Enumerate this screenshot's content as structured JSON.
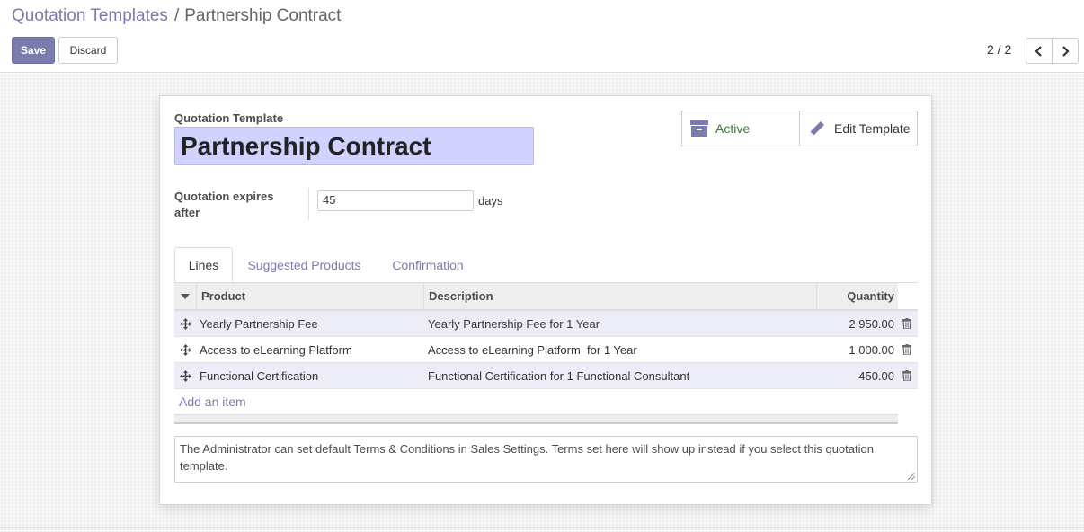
{
  "breadcrumb": {
    "parent": "Quotation Templates",
    "separator": "/",
    "current": "Partnership Contract"
  },
  "actions": {
    "save": "Save",
    "discard": "Discard"
  },
  "pager": {
    "value": "2 / 2"
  },
  "form": {
    "template_label": "Quotation Template",
    "template_name": "Partnership Contract",
    "expires_label": "Quotation expires after",
    "expires_value": "45",
    "expires_unit": "days"
  },
  "smart_buttons": {
    "active": "Active",
    "edit": "Edit Template"
  },
  "tabs": [
    {
      "label": "Lines",
      "active": true
    },
    {
      "label": "Suggested Products"
    },
    {
      "label": "Confirmation"
    }
  ],
  "table": {
    "headers": {
      "product": "Product",
      "description": "Description",
      "quantity": "Quantity"
    },
    "rows": [
      {
        "product": "Yearly Partnership Fee",
        "description": "Yearly Partnership Fee for 1 Year",
        "quantity": "2,950.00"
      },
      {
        "product": "Access to eLearning Platform",
        "description": "Access to eLearning Platform  for 1 Year",
        "quantity": "1,000.00"
      },
      {
        "product": "Functional Certification",
        "description": "Functional Certification for 1 Functional Consultant",
        "quantity": "450.00"
      }
    ],
    "add_item": "Add an item"
  },
  "note": "The Administrator can set default Terms & Conditions in Sales Settings. Terms set here will show up instead if you select this quotation template.",
  "colors": {
    "accent": "#7c7bad",
    "highlight_field": "#d2d2ff",
    "active_green": "#3a7a3a"
  }
}
